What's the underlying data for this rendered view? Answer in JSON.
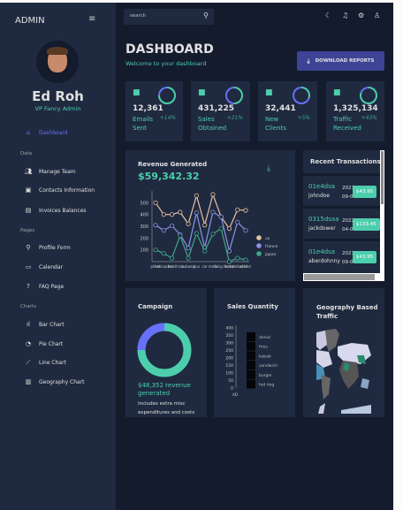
{
  "colors": {
    "sidebar": "#1f2a40",
    "main": "#141b2d",
    "accent_green": "#4cceac",
    "accent_blue": "#6870fa",
    "button": "#3e4396"
  },
  "sidebar": {
    "brand": "ADMIN",
    "menu_icon": "hamburger-icon",
    "user": {
      "name": "Ed Roh",
      "role": "VP Fancy Admin"
    },
    "items": [
      {
        "label": "Dashboard",
        "icon": "home-icon",
        "active": true
      }
    ],
    "sections": [
      {
        "title": "Data",
        "items": [
          {
            "label": "Manage Team",
            "icon": "people-icon"
          },
          {
            "label": "Contacts Information",
            "icon": "contacts-icon"
          },
          {
            "label": "Invoices Balances",
            "icon": "receipt-icon"
          }
        ]
      },
      {
        "title": "Pages",
        "items": [
          {
            "label": "Profile Form",
            "icon": "person-icon"
          },
          {
            "label": "Calendar",
            "icon": "calendar-icon"
          },
          {
            "label": "FAQ Page",
            "icon": "help-icon"
          }
        ]
      },
      {
        "title": "Charts",
        "items": [
          {
            "label": "Bar Chart",
            "icon": "bar-chart-icon"
          },
          {
            "label": "Pie Chart",
            "icon": "pie-chart-icon"
          },
          {
            "label": "Line Chart",
            "icon": "line-chart-icon"
          },
          {
            "label": "Geography Chart",
            "icon": "map-icon"
          }
        ]
      }
    ]
  },
  "topbar": {
    "search_placeholder": "search",
    "icons": [
      "dark-mode-icon",
      "notifications-icon",
      "settings-icon",
      "person-icon"
    ]
  },
  "header": {
    "title": "DASHBOARD",
    "subtitle": "Welcome to your dashboard",
    "download_label": "DOWNLOAD REPORTS"
  },
  "stats": [
    {
      "value": "12,361",
      "label": "Emails Sent",
      "increase": "+14%",
      "icon": "email-icon",
      "progress": 0.75
    },
    {
      "value": "431,225",
      "label": "Sales Obtained",
      "increase": "+21%",
      "icon": "point-of-sale-icon",
      "progress": 0.5
    },
    {
      "value": "32,441",
      "label": "New Clients",
      "increase": "+5%",
      "icon": "person-add-icon",
      "progress": 0.3
    },
    {
      "value": "1,325,134",
      "label": "Traffic Received",
      "increase": "+43%",
      "icon": "traffic-icon",
      "progress": 0.8
    }
  ],
  "revenue": {
    "title": "Revenue Generated",
    "amount": "$59,342.32"
  },
  "chart_data": [
    {
      "type": "line",
      "categories": [
        "plane",
        "helicopter",
        "boat",
        "train",
        "subway",
        "bus",
        "car",
        "moto",
        "bicycle",
        "horse",
        "skateboard",
        "others"
      ],
      "series": [
        {
          "name": "us",
          "color": "#e8c1a0",
          "values": [
            500,
            400,
            400,
            420,
            320,
            560,
            310,
            570,
            380,
            280,
            440,
            435
          ]
        },
        {
          "name": "france",
          "color": "#8f92e6",
          "values": [
            310,
            265,
            305,
            230,
            115,
            415,
            120,
            420,
            380,
            90,
            335,
            265
          ]
        },
        {
          "name": "japan",
          "color": "#3fa88a",
          "values": [
            100,
            70,
            30,
            220,
            30,
            240,
            90,
            235,
            280,
            0,
            30,
            15
          ]
        }
      ],
      "yticks": [
        100,
        200,
        300,
        400,
        500
      ],
      "ylim": [
        0,
        600
      ],
      "legend": "right"
    },
    {
      "type": "bar",
      "title": "Sales Quantity",
      "categories": [
        "AD"
      ],
      "series": [
        {
          "name": "donut"
        },
        {
          "name": "fries"
        },
        {
          "name": "kebab"
        },
        {
          "name": "sandwich"
        },
        {
          "name": "burger"
        },
        {
          "name": "hot dog"
        }
      ],
      "yticks": [
        0,
        50,
        100,
        150,
        200,
        250,
        300,
        350,
        400
      ],
      "ylim": [
        0,
        400
      ],
      "legend": "right"
    }
  ],
  "transactions": {
    "title": "Recent Transactions",
    "items": [
      {
        "id": "01e4dsa",
        "user": "johndoe",
        "date": "2021-09-01",
        "cost": "$43.95"
      },
      {
        "id": "0315dsaa",
        "user": "jackdower",
        "date": "2022-04-01",
        "cost": "$133.45"
      },
      {
        "id": "01e4dsa",
        "user": "aberdohnny",
        "date": "2021-09-01",
        "cost": "$43.95"
      }
    ]
  },
  "campaign": {
    "title": "Campaign",
    "progress": 0.75,
    "revenue": "$48,352 revenue generated",
    "note": "Includes extra misc expenditures and costs"
  },
  "geography": {
    "title": "Geography Based Traffic"
  }
}
